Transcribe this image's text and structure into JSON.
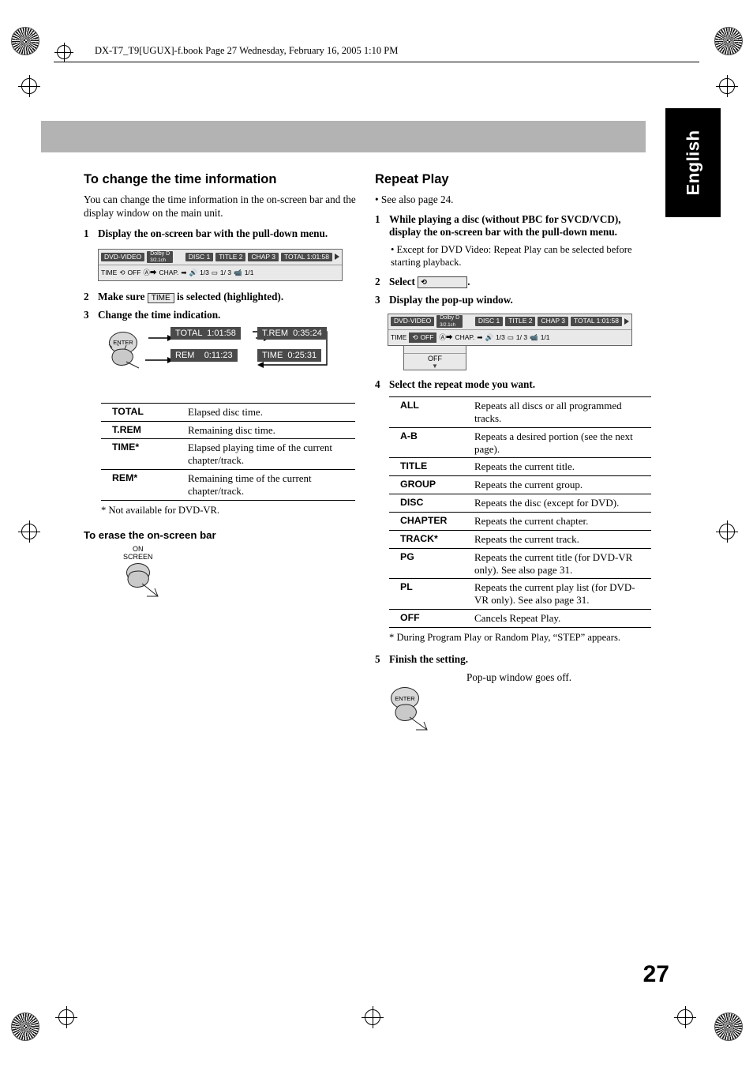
{
  "header": {
    "text": "DX-T7_T9[UGUX]-f.book  Page 27  Wednesday, February 16, 2005  1:10 PM"
  },
  "tab": {
    "label": "English"
  },
  "page_number": "27",
  "left": {
    "title": "To change the time information",
    "intro": "You can change the time information in the on-screen bar and the display window on the main unit.",
    "steps": [
      {
        "num": "1",
        "text": "Display the on-screen bar with the pull-down menu."
      },
      {
        "num": "2",
        "text_pre": "Make sure",
        "chip": "TIME",
        "text_post": "is selected (highlighted)."
      },
      {
        "num": "3",
        "text": "Change the time indication."
      }
    ],
    "onscreen_bar": {
      "disc_type": "DVD-VIDEO",
      "audio_main": "Dolby D",
      "audio_sub": "3/2.1ch",
      "disc": "DISC 1",
      "title": "TITLE  2",
      "chapter": "CHAP  3",
      "total_label": "TOTAL",
      "total_value": "1:01:58",
      "row2": {
        "time": "TIME",
        "off": "OFF",
        "chap": "CHAP.",
        "audio_track": "1/3",
        "subtitle": "1/ 3",
        "angle": "1/1"
      }
    },
    "enter_diagram": {
      "enter_label": "ENTER",
      "boxes": [
        {
          "label": "TOTAL",
          "value": "1:01:58"
        },
        {
          "label": "T.REM",
          "value": "0:35:24"
        },
        {
          "label": "REM",
          "value": "0:11:23"
        },
        {
          "label": "TIME",
          "value": "0:25:31"
        }
      ]
    },
    "time_table": [
      {
        "key": "TOTAL",
        "star": "",
        "desc": "Elapsed disc time."
      },
      {
        "key": "T.REM",
        "star": "",
        "desc": "Remaining disc time."
      },
      {
        "key": "TIME",
        "star": "*",
        "desc": "Elapsed playing time of the current chapter/track."
      },
      {
        "key": "REM",
        "star": "*",
        "desc": "Remaining time of the current chapter/track."
      }
    ],
    "footnote": "* Not available for DVD-VR.",
    "erase_head": "To erase the on-screen bar",
    "onscreen_button": {
      "line1": "ON",
      "line2": "SCREEN"
    }
  },
  "right": {
    "title": "Repeat Play",
    "see_also": "• See also page 24.",
    "steps": [
      {
        "num": "1",
        "text": "While playing a disc (without PBC for SVCD/VCD), display the on-screen bar with the pull-down menu."
      },
      {
        "num": "2",
        "text": "Select"
      },
      {
        "num": "3",
        "text": "Display the pop-up window."
      },
      {
        "num": "4",
        "text": "Select the repeat mode you want."
      },
      {
        "num": "5",
        "text": "Finish the setting."
      }
    ],
    "step1_sub": "• Except for DVD Video: Repeat Play can be selected before starting playback.",
    "onscreen_bar": {
      "disc_type": "DVD-VIDEO",
      "audio_main": "Dolby D",
      "audio_sub": "3/2.1ch",
      "disc": "DISC 1",
      "title": "TITLE  2",
      "chapter": "CHAP  3",
      "total_label": "TOTAL",
      "total_value": "1:01:58",
      "row2": {
        "time": "TIME",
        "off": "OFF",
        "chap": "CHAP.",
        "audio_track": "1/3",
        "subtitle": "1/ 3",
        "angle": "1/1"
      },
      "popup_value": "OFF"
    },
    "repeat_table": [
      {
        "key": "ALL",
        "star": "",
        "desc": "Repeats all discs or all programmed tracks."
      },
      {
        "key": "A-B",
        "star": "",
        "desc": "Repeats a desired portion (see the next page)."
      },
      {
        "key": "TITLE",
        "star": "",
        "desc": "Repeats the current title."
      },
      {
        "key": "GROUP",
        "star": "",
        "desc": "Repeats the current group."
      },
      {
        "key": "DISC",
        "star": "",
        "desc": "Repeats the disc (except for DVD)."
      },
      {
        "key": "CHAPTER",
        "star": "",
        "desc": "Repeats the current chapter."
      },
      {
        "key": "TRACK",
        "star": "*",
        "desc": "Repeats the current track."
      },
      {
        "key": "PG",
        "star": "",
        "desc": "Repeats the current title (for DVD-VR only). See also page 31."
      },
      {
        "key": "PL",
        "star": "",
        "desc": "Repeats the current play list (for DVD-VR only). See also page 31."
      },
      {
        "key": "OFF",
        "star": "",
        "desc": "Cancels Repeat Play."
      }
    ],
    "footnote": "* During Program Play or Random Play, “STEP” appears.",
    "popup_off_note": "Pop-up window goes off.",
    "enter_label": "ENTER"
  }
}
